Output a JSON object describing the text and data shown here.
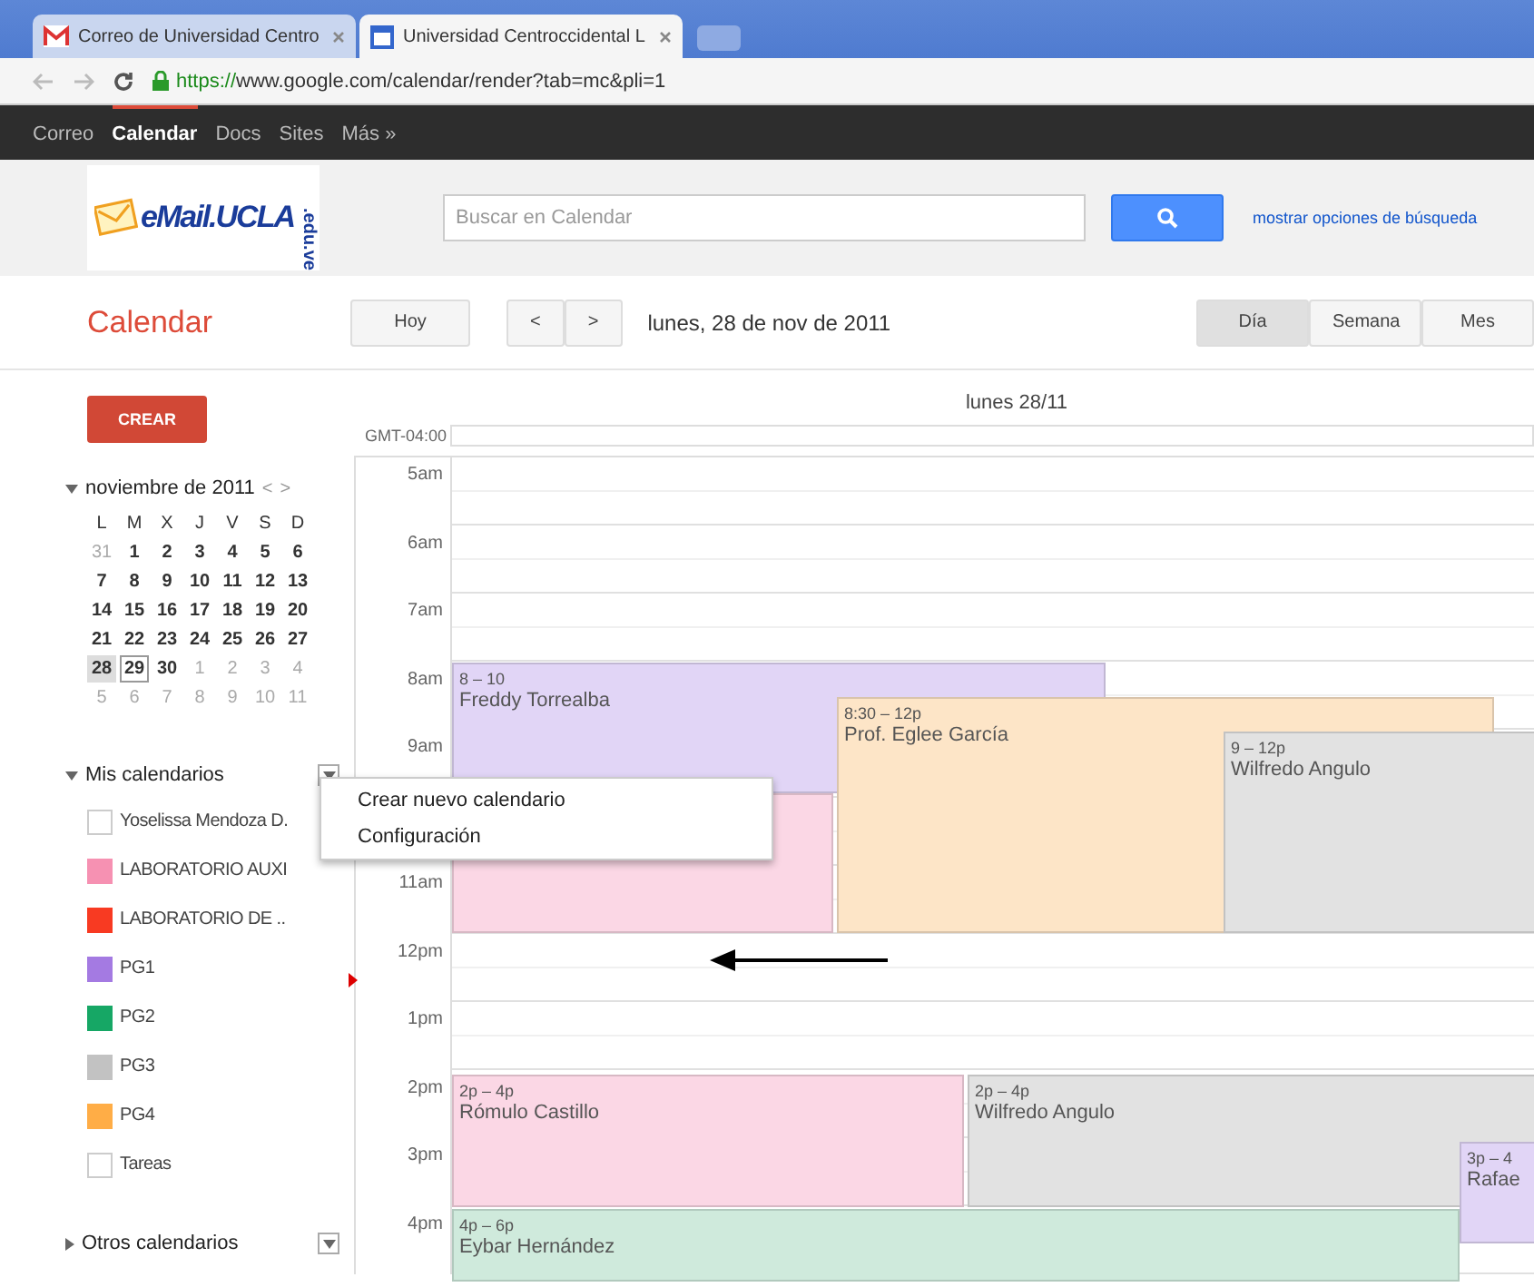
{
  "browser": {
    "tabs": [
      {
        "title": "Correo de Universidad Centro",
        "kind": "mail",
        "selected": false
      },
      {
        "title": "Universidad Centroccidental L",
        "kind": "calendar",
        "selected": true
      }
    ],
    "url_secure": "https://",
    "url_rest": "www.google.com/calendar/render?tab=mc&pli=1"
  },
  "top_nav": [
    {
      "label": "Correo",
      "selected": false
    },
    {
      "label": "Calendar",
      "selected": true
    },
    {
      "label": "Docs",
      "selected": false
    },
    {
      "label": "Sites",
      "selected": false
    },
    {
      "label": "Más »",
      "selected": false
    }
  ],
  "logo": {
    "text": "eMail.UCLA",
    "suffix": ".edu.ve"
  },
  "search": {
    "placeholder": "Buscar en Calendar",
    "options_link": "mostrar opciones de búsqueda"
  },
  "toolbar": {
    "app_title": "Calendar",
    "today": "Hoy",
    "prev": "<",
    "next": ">",
    "date": "lunes, 28 de nov de 2011",
    "views": [
      {
        "label": "Día",
        "selected": true
      },
      {
        "label": "Semana",
        "selected": false
      },
      {
        "label": "Mes",
        "selected": false
      }
    ]
  },
  "sidebar": {
    "create": "CREAR",
    "mini_calendar": {
      "title": "noviembre de 2011",
      "prev": "<",
      "next": ">",
      "weekdays": [
        "L",
        "M",
        "X",
        "J",
        "V",
        "S",
        "D"
      ],
      "weeks": [
        [
          {
            "d": "31",
            "other_month": true,
            "selected": false,
            "today": false
          },
          {
            "d": "1",
            "other_month": false,
            "selected": false,
            "today": false
          },
          {
            "d": "2",
            "other_month": false,
            "selected": false,
            "today": false
          },
          {
            "d": "3",
            "other_month": false,
            "selected": false,
            "today": false
          },
          {
            "d": "4",
            "other_month": false,
            "selected": false,
            "today": false
          },
          {
            "d": "5",
            "other_month": false,
            "selected": false,
            "today": false
          },
          {
            "d": "6",
            "other_month": false,
            "selected": false,
            "today": false
          }
        ],
        [
          {
            "d": "7",
            "other_month": false,
            "selected": false,
            "today": false
          },
          {
            "d": "8",
            "other_month": false,
            "selected": false,
            "today": false
          },
          {
            "d": "9",
            "other_month": false,
            "selected": false,
            "today": false
          },
          {
            "d": "10",
            "other_month": false,
            "selected": false,
            "today": false
          },
          {
            "d": "11",
            "other_month": false,
            "selected": false,
            "today": false
          },
          {
            "d": "12",
            "other_month": false,
            "selected": false,
            "today": false
          },
          {
            "d": "13",
            "other_month": false,
            "selected": false,
            "today": false
          }
        ],
        [
          {
            "d": "14",
            "other_month": false,
            "selected": false,
            "today": false
          },
          {
            "d": "15",
            "other_month": false,
            "selected": false,
            "today": false
          },
          {
            "d": "16",
            "other_month": false,
            "selected": false,
            "today": false
          },
          {
            "d": "17",
            "other_month": false,
            "selected": false,
            "today": false
          },
          {
            "d": "18",
            "other_month": false,
            "selected": false,
            "today": false
          },
          {
            "d": "19",
            "other_month": false,
            "selected": false,
            "today": false
          },
          {
            "d": "20",
            "other_month": false,
            "selected": false,
            "today": false
          }
        ],
        [
          {
            "d": "21",
            "other_month": false,
            "selected": false,
            "today": false
          },
          {
            "d": "22",
            "other_month": false,
            "selected": false,
            "today": false
          },
          {
            "d": "23",
            "other_month": false,
            "selected": false,
            "today": false
          },
          {
            "d": "24",
            "other_month": false,
            "selected": false,
            "today": false
          },
          {
            "d": "25",
            "other_month": false,
            "selected": false,
            "today": false
          },
          {
            "d": "26",
            "other_month": false,
            "selected": false,
            "today": false
          },
          {
            "d": "27",
            "other_month": false,
            "selected": false,
            "today": false
          }
        ],
        [
          {
            "d": "28",
            "other_month": false,
            "selected": true,
            "today": false
          },
          {
            "d": "29",
            "other_month": false,
            "selected": false,
            "today": true
          },
          {
            "d": "30",
            "other_month": false,
            "selected": false,
            "today": false
          },
          {
            "d": "1",
            "other_month": true,
            "selected": false,
            "today": false
          },
          {
            "d": "2",
            "other_month": true,
            "selected": false,
            "today": false
          },
          {
            "d": "3",
            "other_month": true,
            "selected": false,
            "today": false
          },
          {
            "d": "4",
            "other_month": true,
            "selected": false,
            "today": false
          }
        ],
        [
          {
            "d": "5",
            "other_month": true,
            "selected": false,
            "today": false
          },
          {
            "d": "6",
            "other_month": true,
            "selected": false,
            "today": false
          },
          {
            "d": "7",
            "other_month": true,
            "selected": false,
            "today": false
          },
          {
            "d": "8",
            "other_month": true,
            "selected": false,
            "today": false
          },
          {
            "d": "9",
            "other_month": true,
            "selected": false,
            "today": false
          },
          {
            "d": "10",
            "other_month": true,
            "selected": false,
            "today": false
          },
          {
            "d": "11",
            "other_month": true,
            "selected": false,
            "today": false
          }
        ]
      ]
    },
    "my_calendars": {
      "title": "Mis calendarios",
      "expanded": true,
      "items": [
        {
          "label": "Yoselissa Mendoza D.",
          "checked": false
        },
        {
          "label": "LABORATORIO AUXI",
          "checked": true,
          "color": "#f691b2"
        },
        {
          "label": "LABORATORIO DE ..",
          "checked": true,
          "color": "#f83a22"
        },
        {
          "label": "PG1",
          "checked": true,
          "color": "#a47ae2"
        },
        {
          "label": "PG2",
          "checked": true,
          "color": "#16a765"
        },
        {
          "label": "PG3",
          "checked": true,
          "color": "#c2c2c2"
        },
        {
          "label": "PG4",
          "checked": true,
          "color": "#ffad46"
        },
        {
          "label": "Tareas",
          "checked": false
        }
      ]
    },
    "other_calendars": {
      "title": "Otros calendarios",
      "expanded": false
    }
  },
  "context_menu": [
    "Crear nuevo calendario",
    "Configuración"
  ],
  "day_view": {
    "day_header": "lunes 28/11",
    "timezone": "GMT-04:00",
    "hours": [
      {
        "label": "5am"
      },
      {
        "label": "6am"
      },
      {
        "label": "7am"
      },
      {
        "label": "8am"
      },
      {
        "label": "9am"
      },
      {
        "label": "11am"
      },
      {
        "label": "12pm"
      },
      {
        "label": "1pm"
      },
      {
        "label": "2pm"
      },
      {
        "label": "3pm"
      },
      {
        "label": "4pm"
      }
    ],
    "events": [
      {
        "time": "8 – 10",
        "title": "Freddy Torrealba",
        "color": "#e1d5f6"
      },
      {
        "color": "#fbd7e5"
      },
      {
        "time": "8:30 – 12p",
        "title": "Prof. Eglee García",
        "color": "#fde5c7"
      },
      {
        "time": "9 – 12p",
        "title": "Wilfredo Angulo",
        "color": "#e2e2e2"
      },
      {
        "time": "2p – 4p",
        "title": "Rómulo Castillo",
        "color": "#fbd7e5"
      },
      {
        "time": "2p – 4p",
        "title": "Wilfredo Angulo",
        "color": "#e2e2e2"
      },
      {
        "time": "3p – 4",
        "title": "Rafae",
        "color": "#e1d5f6"
      },
      {
        "time": "4p – 6p",
        "title": "Eybar Hernández",
        "color": "#cfeadc"
      }
    ]
  }
}
